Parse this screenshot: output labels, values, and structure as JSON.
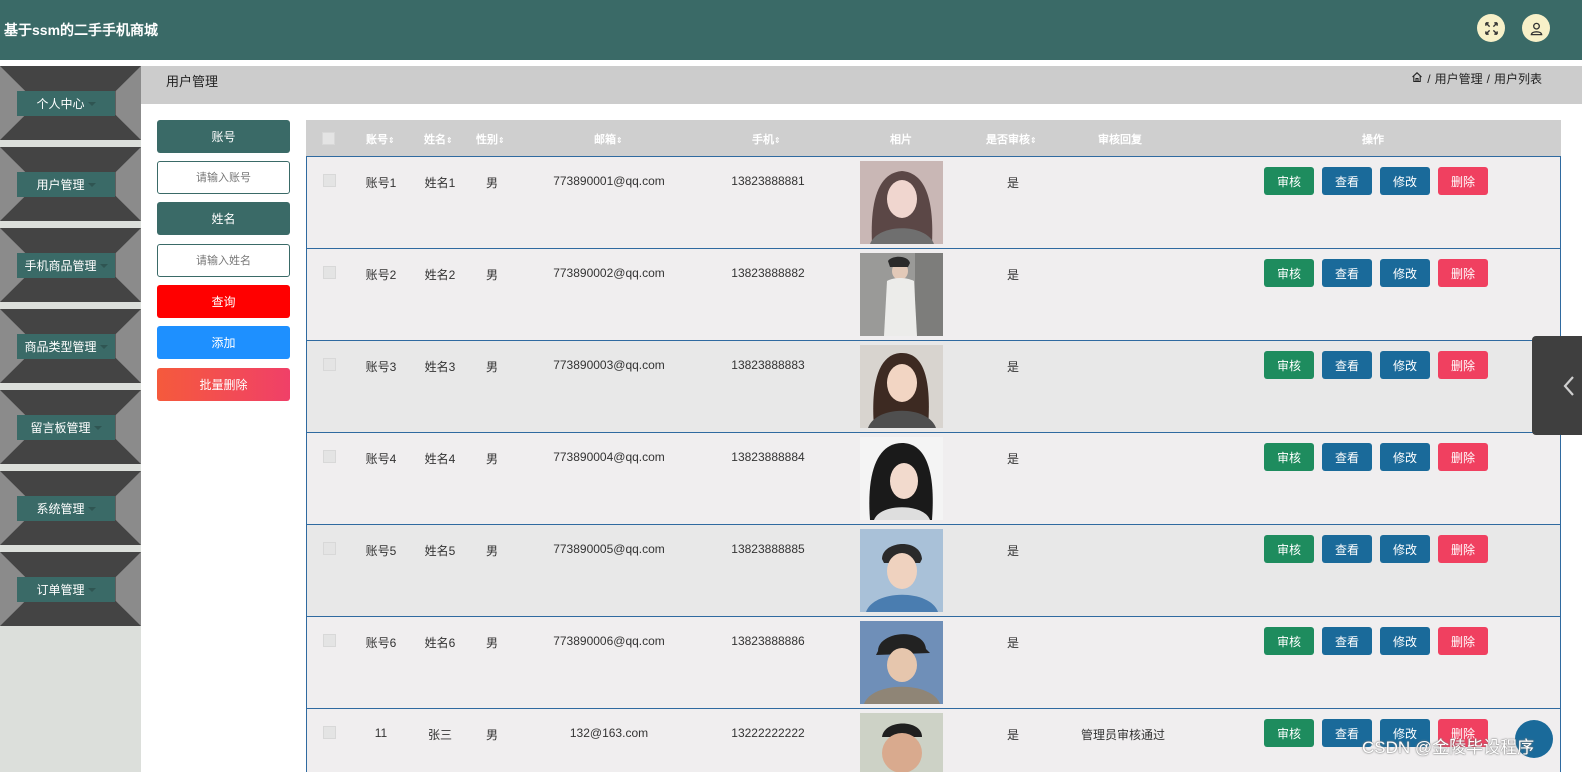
{
  "app": {
    "title": "基于ssm的二手手机商城"
  },
  "sidebar": {
    "items": [
      {
        "label": "个人中心"
      },
      {
        "label": "用户管理"
      },
      {
        "label": "手机商品管理"
      },
      {
        "label": "商品类型管理"
      },
      {
        "label": "留言板管理"
      },
      {
        "label": "系统管理"
      },
      {
        "label": "订单管理"
      }
    ]
  },
  "breadcrumb": {
    "page_title": "用户管理",
    "level1": "用户管理",
    "level2": "用户列表",
    "sep": "/"
  },
  "filters": {
    "account_label": "账号",
    "account_placeholder": "请输入账号",
    "name_label": "姓名",
    "name_placeholder": "请输入姓名",
    "query_label": "查询",
    "add_label": "添加",
    "batch_delete_label": "批量删除"
  },
  "table": {
    "headers": {
      "account": "账号",
      "name": "姓名",
      "gender": "性别",
      "email": "邮箱",
      "phone": "手机",
      "photo": "相片",
      "audited": "是否审核",
      "reply": "审核回复",
      "ops": "操作"
    },
    "sort_mark": "⇕",
    "actions": {
      "audit": "审核",
      "view": "查看",
      "edit": "修改",
      "delete": "删除"
    },
    "rows": [
      {
        "account": "账号1",
        "name": "姓名1",
        "gender": "男",
        "email": "773890001@qq.com",
        "phone": "13823888881",
        "audited": "是",
        "reply": ""
      },
      {
        "account": "账号2",
        "name": "姓名2",
        "gender": "男",
        "email": "773890002@qq.com",
        "phone": "13823888882",
        "audited": "是",
        "reply": ""
      },
      {
        "account": "账号3",
        "name": "姓名3",
        "gender": "男",
        "email": "773890003@qq.com",
        "phone": "13823888883",
        "audited": "是",
        "reply": ""
      },
      {
        "account": "账号4",
        "name": "姓名4",
        "gender": "男",
        "email": "773890004@qq.com",
        "phone": "13823888884",
        "audited": "是",
        "reply": ""
      },
      {
        "account": "账号5",
        "name": "姓名5",
        "gender": "男",
        "email": "773890005@qq.com",
        "phone": "13823888885",
        "audited": "是",
        "reply": ""
      },
      {
        "account": "账号6",
        "name": "姓名6",
        "gender": "男",
        "email": "773890006@qq.com",
        "phone": "13823888886",
        "audited": "是",
        "reply": ""
      },
      {
        "account": "11",
        "name": "张三",
        "gender": "男",
        "email": "132@163.com",
        "phone": "13222222222",
        "audited": "是",
        "reply": "管理员审核通过"
      }
    ]
  },
  "watermark": "CSDN @金陵毕设程序",
  "colors": {
    "primary": "#3a6a67",
    "query": "#ff0000",
    "add": "#1e90ff",
    "delete": "#f04060",
    "audit": "#1e8c5e",
    "view": "#1a6a9a"
  }
}
